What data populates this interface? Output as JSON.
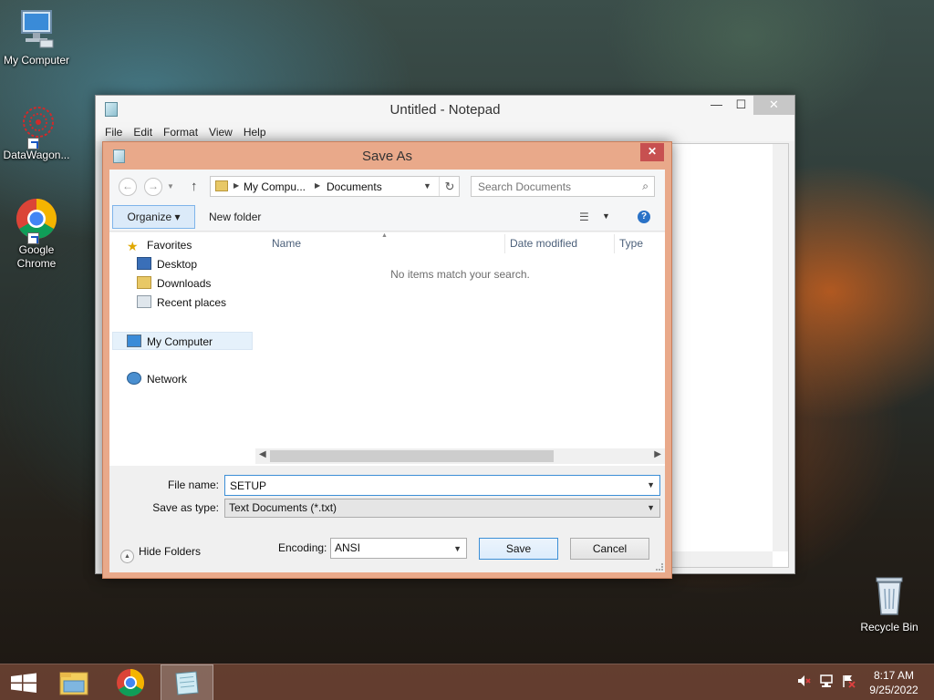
{
  "desktop": {
    "icons": [
      {
        "label": "My Computer",
        "icon": "computer-icon"
      },
      {
        "label": "DataWagon...",
        "icon": "datawagon-icon"
      },
      {
        "label": "Google Chrome",
        "icon": "chrome-icon"
      }
    ],
    "recycle_bin": "Recycle Bin"
  },
  "notepad": {
    "title": "Untitled - Notepad",
    "menu": [
      "File",
      "Edit",
      "Format",
      "View",
      "Help"
    ],
    "controls": {
      "minimize": "—",
      "maximize": "☐",
      "close": "✕"
    }
  },
  "save_dialog": {
    "title": "Save As",
    "close": "✕",
    "address": {
      "crumbs": [
        "My Compu...",
        "Documents"
      ]
    },
    "search": {
      "placeholder": "Search Documents"
    },
    "toolbar": {
      "organize": "Organize ▾",
      "new_folder": "New folder"
    },
    "nav": {
      "favorites": "Favorites",
      "desktop": "Desktop",
      "downloads": "Downloads",
      "recent": "Recent places",
      "computer": "My Computer",
      "network": "Network"
    },
    "columns": [
      "Name",
      "Date modified",
      "Type"
    ],
    "empty_message": "No items match your search.",
    "file_name_label": "File name:",
    "file_name_value": "SETUP",
    "save_type_label": "Save as type:",
    "save_type_value": "Text Documents (*.txt)",
    "hide_folders": "Hide Folders",
    "encoding_label": "Encoding:",
    "encoding_value": "ANSI",
    "save_button": "Save",
    "cancel_button": "Cancel"
  },
  "taskbar": {
    "time": "8:17 AM",
    "date": "9/25/2022"
  },
  "colors": {
    "dialog_frame": "#e9a98a",
    "close_red": "#c75050",
    "taskbar": "#69413a",
    "accent_blue": "#3c8fd6"
  }
}
